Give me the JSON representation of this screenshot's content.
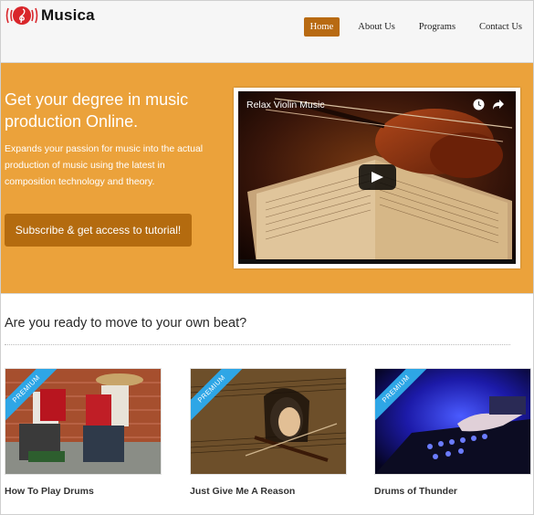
{
  "header": {
    "logo_text": "Musica",
    "nav": [
      {
        "label": "Home",
        "active": true
      },
      {
        "label": "About Us",
        "active": false
      },
      {
        "label": "Programs",
        "active": false
      },
      {
        "label": "Contact Us",
        "active": false
      }
    ]
  },
  "hero": {
    "title": "Get your degree in music production Online.",
    "description": "Expands your passion for music into the actual production of music using the latest in composition technology and theory.",
    "cta_label": "Subscribe & get access to tutorial!",
    "video": {
      "title": "Relax Violin Music",
      "icons": [
        "clock-icon",
        "share-icon",
        "play-icon"
      ]
    }
  },
  "section": {
    "title": "Are you ready to move to your own beat?",
    "cards": [
      {
        "title": "How To Play Drums",
        "badge": "PREMIUM"
      },
      {
        "title": "Just Give Me A Reason",
        "badge": "PREMIUM"
      },
      {
        "title": "Drums of Thunder",
        "badge": "PREMIUM"
      }
    ]
  },
  "colors": {
    "hero_background": "#eba23b",
    "accent_button": "#b46b0f",
    "ribbon": "#2ea6e6",
    "logo_red": "#d9262b"
  }
}
